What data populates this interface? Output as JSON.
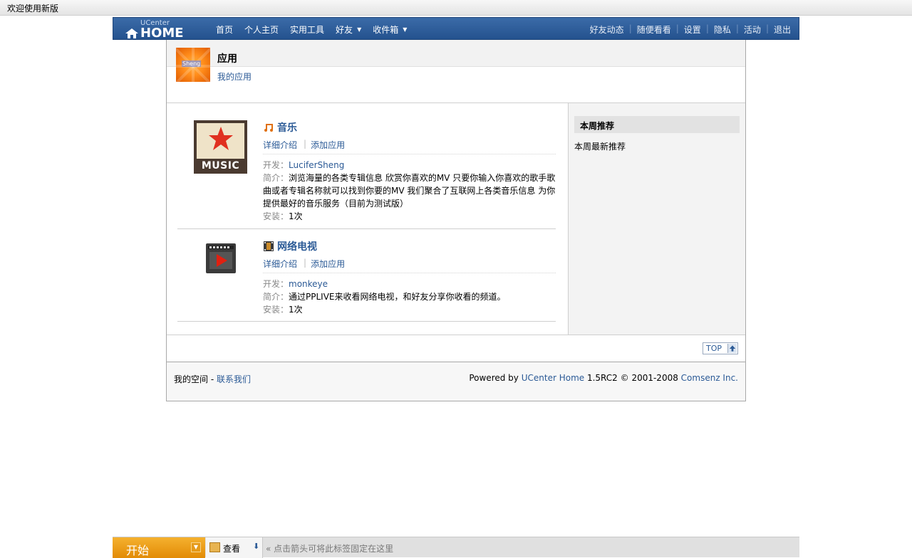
{
  "topbar": {
    "welcome": "欢迎使用新版"
  },
  "header": {
    "logo_top": "UCenter",
    "logo_main": "HOME",
    "nav_left": [
      {
        "label": "首页",
        "dropdown": false
      },
      {
        "label": "个人主页",
        "dropdown": false
      },
      {
        "label": "实用工具",
        "dropdown": false
      },
      {
        "label": "好友",
        "dropdown": true
      },
      {
        "label": "收件箱",
        "dropdown": true
      }
    ],
    "nav_right": [
      "好友动态",
      "随便看看",
      "设置",
      "隐私",
      "活动",
      "退出"
    ]
  },
  "page": {
    "avatar_text": "Sheng",
    "title": "应用",
    "sub_link": "我的应用"
  },
  "apps": [
    {
      "name": "音乐",
      "icon": "music-note-icon",
      "art_text": "MUSIC",
      "actions": [
        "详细介绍",
        "添加应用"
      ],
      "dev_label": "开发：",
      "developer": "LuciferSheng",
      "desc_label": "简介：",
      "description": "浏览海量的各类专辑信息 欣赏你喜欢的MV 只要你输入你喜欢的歌手歌曲或者专辑名称就可以找到你要的MV 我们聚合了互联网上各类音乐信息 为你提供最好的音乐服务（目前为测试版）",
      "install_label": "安装：",
      "installs": "1次"
    },
    {
      "name": "网络电视",
      "icon": "film-icon",
      "art_text": "",
      "actions": [
        "详细介绍",
        "添加应用"
      ],
      "dev_label": "开发：",
      "developer": "monkeye",
      "desc_label": "简介：",
      "description": "通过PPLIVE来收看网络电视，和好友分享你收看的频道。",
      "install_label": "安装：",
      "installs": "1次"
    }
  ],
  "sidebar": {
    "heading": "本周推荐",
    "text": "本周最新推荐"
  },
  "footer": {
    "top_label": "TOP",
    "left_text": "我的空间",
    "left_dash": " - ",
    "contact": "联系我们",
    "powered": "Powered by ",
    "product": "UCenter Home",
    "version": " 1.5RC2 © 2001-2008 ",
    "company": "Comsenz Inc."
  },
  "taskbar": {
    "start": "开始",
    "view": "查看",
    "hint": "« 点击箭头可将此标签固定在这里"
  },
  "colors": {
    "header_blue": "#2b5a96",
    "link": "#2b5a96",
    "start_orange": "#f0a020"
  }
}
